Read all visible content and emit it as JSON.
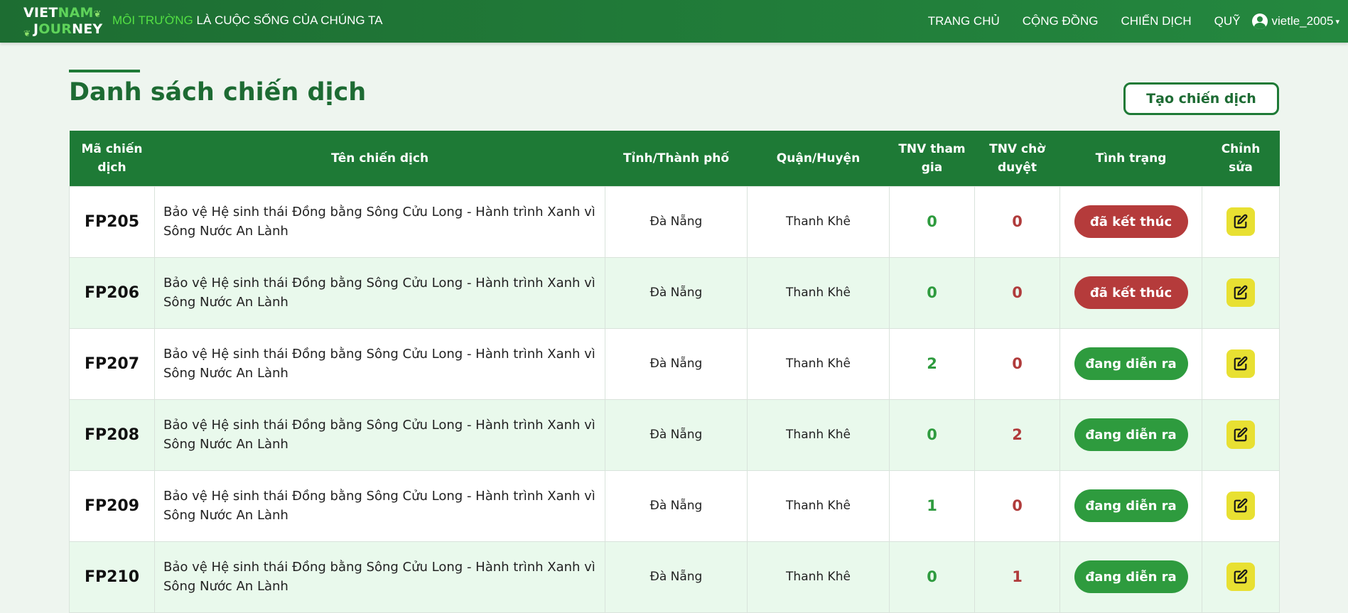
{
  "navbar": {
    "logo_line1_a": "VIET",
    "logo_line1_b": "NAM",
    "logo_line2_a": "J",
    "logo_line2_b": "OUR",
    "logo_line2_c": "NEY",
    "slogan_highlight": "MÔI TRƯỜNG",
    "slogan_rest": " LÀ CUỘC SỐNG CỦA CHÚNG TA",
    "links": [
      "TRANG CHỦ",
      "CỘNG ĐỒNG",
      "CHIẾN DỊCH",
      "QUỸ"
    ],
    "username": "vietle_2005"
  },
  "page": {
    "title": "Danh sách chiến dịch",
    "create_button": "Tạo chiến dịch"
  },
  "table": {
    "headers": [
      "Mã chiến dịch",
      "Tên chiến dịch",
      "Tỉnh/Thành phố",
      "Quận/Huyện",
      "TNV tham gia",
      "TNV chờ duyệt",
      "Tình trạng",
      "Chỉnh sửa"
    ],
    "rows": [
      {
        "code": "FP205",
        "name": "Bảo vệ Hệ sinh thái Đồng bằng Sông Cửu Long - Hành trình Xanh vì Sông Nước An Lành",
        "province": "Đà Nẵng",
        "district": "Thanh Khê",
        "joined": "0",
        "pending": "0",
        "status": "đã kết thúc"
      },
      {
        "code": "FP206",
        "name": "Bảo vệ Hệ sinh thái Đồng bằng Sông Cửu Long - Hành trình Xanh vì Sông Nước An Lành",
        "province": "Đà Nẵng",
        "district": "Thanh Khê",
        "joined": "0",
        "pending": "0",
        "status": "đã kết thúc"
      },
      {
        "code": "FP207",
        "name": "Bảo vệ Hệ sinh thái Đồng bằng Sông Cửu Long - Hành trình Xanh vì Sông Nước An Lành",
        "province": "Đà Nẵng",
        "district": "Thanh Khê",
        "joined": "2",
        "pending": "0",
        "status": "đang diễn ra"
      },
      {
        "code": "FP208",
        "name": "Bảo vệ Hệ sinh thái Đồng bằng Sông Cửu Long - Hành trình Xanh vì Sông Nước An Lành",
        "province": "Đà Nẵng",
        "district": "Thanh Khê",
        "joined": "0",
        "pending": "2",
        "status": "đang diễn ra"
      },
      {
        "code": "FP209",
        "name": "Bảo vệ Hệ sinh thái Đồng bằng Sông Cửu Long - Hành trình Xanh vì Sông Nước An Lành",
        "province": "Đà Nẵng",
        "district": "Thanh Khê",
        "joined": "1",
        "pending": "0",
        "status": "đang diễn ra"
      },
      {
        "code": "FP210",
        "name": "Bảo vệ Hệ sinh thái Đồng bằng Sông Cửu Long - Hành trình Xanh vì Sông Nước An Lành",
        "province": "Đà Nẵng",
        "district": "Thanh Khê",
        "joined": "0",
        "pending": "1",
        "status": "đang diễn ra"
      }
    ]
  },
  "colors": {
    "brand_green": "#1e7a36",
    "status_ended": "#b53b3b",
    "status_ongoing": "#2e9b3e",
    "edit_button": "#e8e032"
  },
  "icons": {
    "edit": "edit-icon",
    "user": "user-circle-icon",
    "caret": "caret-down-icon"
  }
}
